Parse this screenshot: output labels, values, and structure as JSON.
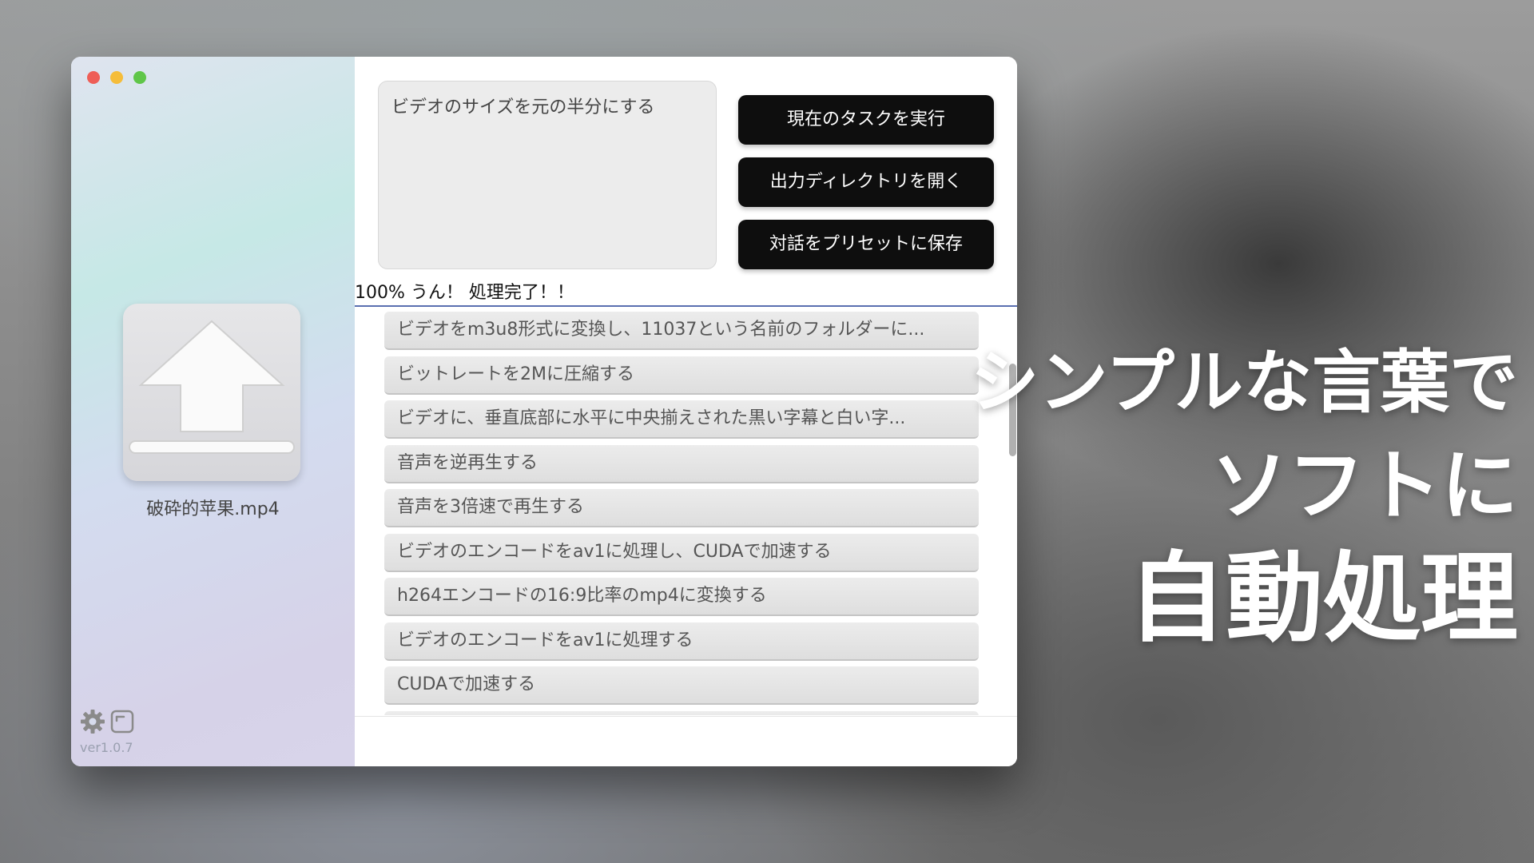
{
  "sidebar": {
    "file_name": "破砕的苹果.mp4",
    "version": "ver1.0.7"
  },
  "prompt": {
    "text": "ビデオのサイズを元の半分にする"
  },
  "buttons": {
    "run": "現在のタスクを実行",
    "open_output": "出力ディレクトリを開く",
    "save_preset": "対話をプリセットに保存"
  },
  "status": {
    "text": "100% うん！ 処理完了！！",
    "progress": 1.0
  },
  "presets": [
    "ビデオをm3u8形式に変換し、11037という名前のフォルダーに...",
    "ビットレートを2Mに圧縮する",
    "ビデオに、垂直底部に水平に中央揃えされた黒い字幕と白い字...",
    "音声を逆再生する",
    "音声を3倍速で再生する",
    "ビデオのエンコードをav1に処理し、CUDAで加速する",
    "h264エンコードの16:9比率のmp4に変換する",
    "ビデオのエンコードをav1に処理する",
    "CUDAで加速する",
    ""
  ],
  "headline": {
    "line1": "シンプルな言葉で",
    "line2": "ソフトに",
    "line3": "自動処理"
  },
  "colors": {
    "button_bg": "#0e0e0e",
    "progress": "#5a6fb0",
    "close": "#ee5e57",
    "minimize": "#f5bd3a",
    "maximize": "#5fc649"
  },
  "icons": [
    "close-icon",
    "minimize-icon",
    "maximize-icon",
    "upload-arrow-icon",
    "gear-icon",
    "window-icon"
  ]
}
